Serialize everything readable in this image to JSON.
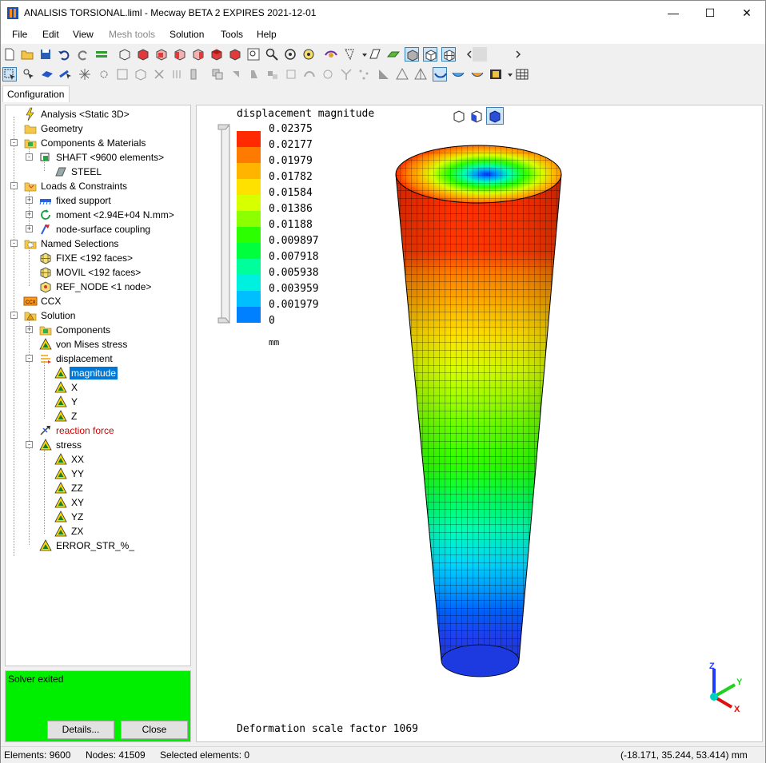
{
  "window": {
    "title": "ANALISIS TORSIONAL.liml - Mecway BETA 2 EXPIRES 2021-12-01",
    "minimize_glyph": "—",
    "maximize_glyph": "☐",
    "close_glyph": "✕"
  },
  "menu": {
    "items": [
      "File",
      "Edit",
      "View",
      "Mesh tools",
      "Solution",
      "Tools",
      "Help"
    ],
    "disabled": [
      "Mesh tools"
    ]
  },
  "tabs": {
    "configuration": "Configuration"
  },
  "tree": {
    "items": [
      {
        "label": "Analysis <Static 3D>",
        "icon": "lightning-icon"
      },
      {
        "label": "Geometry",
        "icon": "folder-icon"
      },
      {
        "label": "Components & Materials",
        "icon": "component-folder-icon"
      },
      {
        "label": "SHAFT <9600 elements>",
        "icon": "component-icon"
      },
      {
        "label": "STEEL",
        "icon": "material-icon"
      },
      {
        "label": "Loads & Constraints",
        "icon": "loads-folder-icon"
      },
      {
        "label": "fixed support",
        "icon": "fixed-support-icon"
      },
      {
        "label": "moment <2.94E+04 N.mm>",
        "icon": "moment-icon"
      },
      {
        "label": "node-surface coupling",
        "icon": "coupling-icon"
      },
      {
        "label": "Named Selections",
        "icon": "selection-folder-icon"
      },
      {
        "label": "FIXE <192 faces>",
        "icon": "faces-icon"
      },
      {
        "label": "MOVIL <192 faces>",
        "icon": "faces-icon"
      },
      {
        "label": "REF_NODE <1 node>",
        "icon": "node-icon"
      },
      {
        "label": "CCX",
        "icon": "ccx-icon"
      },
      {
        "label": "Solution",
        "icon": "solution-folder-icon"
      },
      {
        "label": "Components",
        "icon": "component-folder-icon"
      },
      {
        "label": "von Mises stress",
        "icon": "result-triangle-icon"
      },
      {
        "label": "displacement",
        "icon": "displacement-icon"
      },
      {
        "label": "magnitude",
        "icon": "result-triangle-icon"
      },
      {
        "label": "X",
        "icon": "result-triangle-icon"
      },
      {
        "label": "Y",
        "icon": "result-triangle-icon"
      },
      {
        "label": "Z",
        "icon": "result-triangle-icon"
      },
      {
        "label": "reaction force",
        "icon": "reaction-force-icon"
      },
      {
        "label": "stress",
        "icon": "result-triangle-icon"
      },
      {
        "label": "XX",
        "icon": "result-triangle-icon"
      },
      {
        "label": "YY",
        "icon": "result-triangle-icon"
      },
      {
        "label": "ZZ",
        "icon": "result-triangle-icon"
      },
      {
        "label": "XY",
        "icon": "result-triangle-icon"
      },
      {
        "label": "YZ",
        "icon": "result-triangle-icon"
      },
      {
        "label": "ZX",
        "icon": "result-triangle-icon"
      },
      {
        "label": "ERROR_STR_%_",
        "icon": "result-triangle-icon"
      }
    ],
    "selected": "magnitude",
    "highlight_red": "reaction force"
  },
  "solver": {
    "status": "Solver exited",
    "details_label": "Details...",
    "close_label": "Close",
    "color": "#00ee00"
  },
  "viewport": {
    "legend_title": "displacement magnitude",
    "legend_values": [
      "0.02375",
      "0.02177",
      "0.01979",
      "0.01782",
      "0.01584",
      "0.01386",
      "0.01188",
      "0.009897",
      "0.007918",
      "0.005938",
      "0.003959",
      "0.001979",
      "0"
    ],
    "legend_colors": [
      "#ff2a00",
      "#ff7a00",
      "#ffb400",
      "#ffe100",
      "#d7ff00",
      "#8cff00",
      "#2bff00",
      "#00ff3c",
      "#00ff9a",
      "#00f0e0",
      "#00bfff",
      "#0080ff",
      "#0030ff"
    ],
    "unit": "mm",
    "deformation_text": "Deformation scale factor 1069",
    "axis_labels": {
      "x": "X",
      "y": "Y",
      "z": "Z"
    }
  },
  "status": {
    "elements": "Elements: 9600",
    "nodes": "Nodes: 41509",
    "selected": "Selected elements: 0",
    "coords": "(-18.171, 35.244, 53.414) mm"
  }
}
